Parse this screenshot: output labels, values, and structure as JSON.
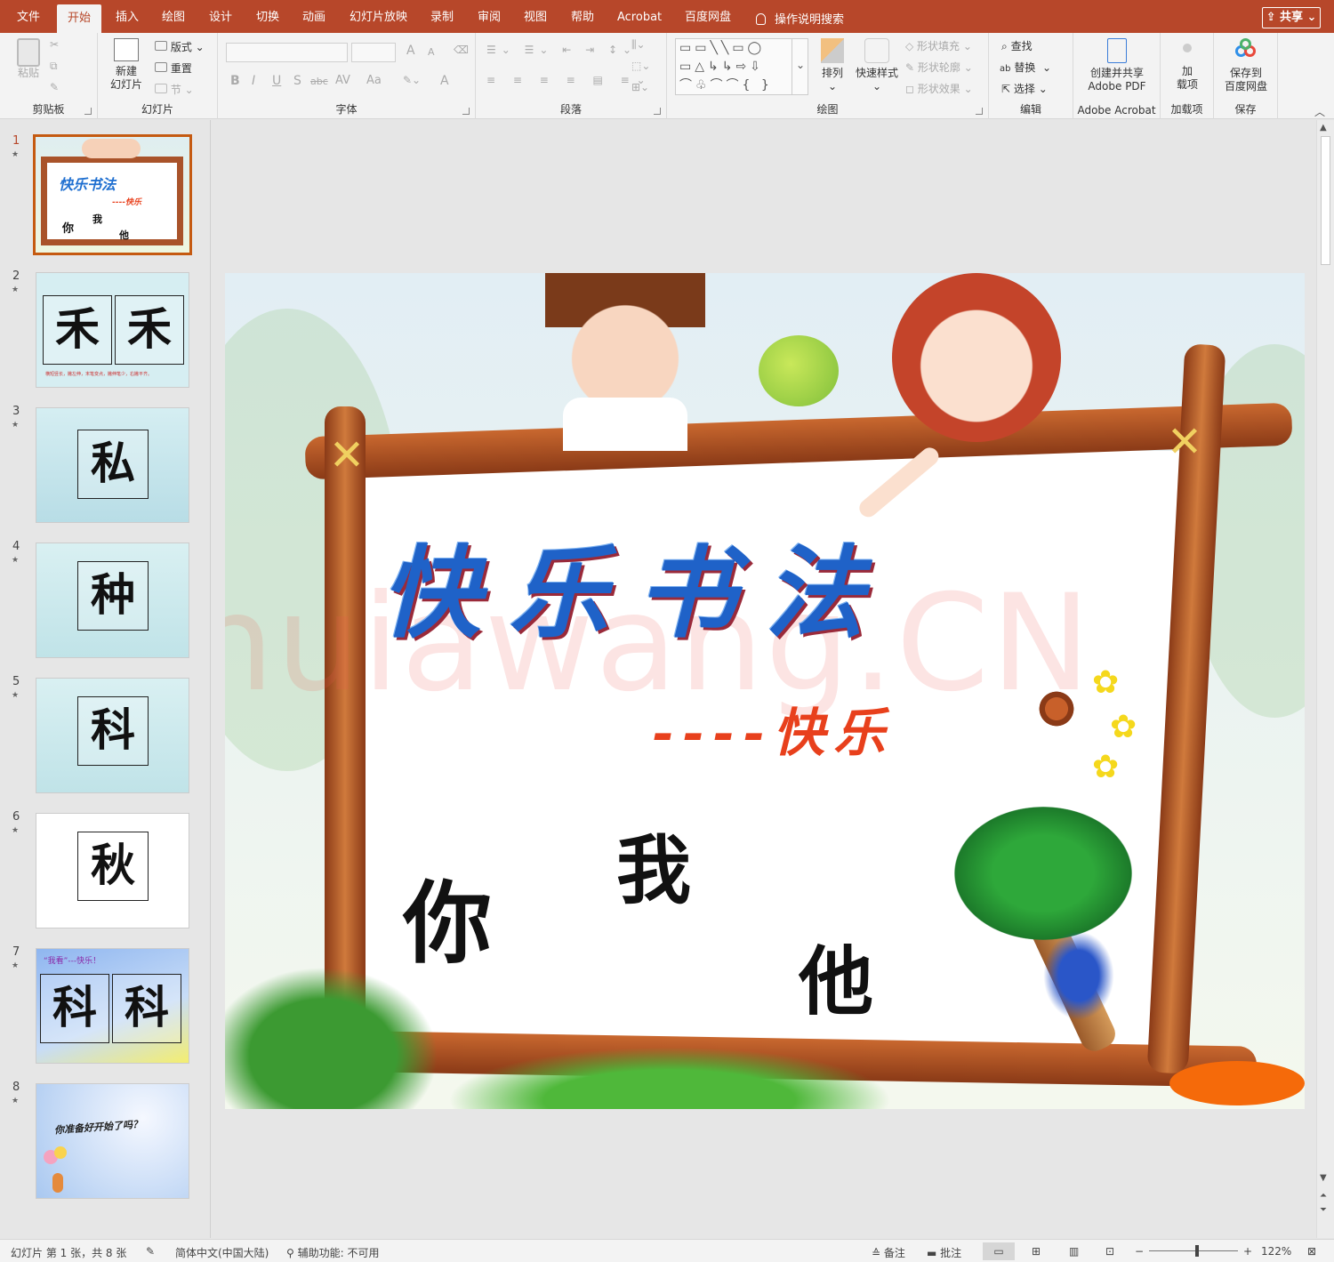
{
  "tabs": [
    "文件",
    "开始",
    "插入",
    "绘图",
    "设计",
    "切换",
    "动画",
    "幻灯片放映",
    "录制",
    "审阅",
    "视图",
    "帮助",
    "Acrobat",
    "百度网盘"
  ],
  "active_tab": "开始",
  "tell_me": "操作说明搜索",
  "share": "共享",
  "ribbon": {
    "clipboard": {
      "label": "剪贴板",
      "paste": "粘贴"
    },
    "slides": {
      "label": "幻灯片",
      "new_slide_1": "新建",
      "new_slide_2": "幻灯片",
      "layout": "版式",
      "reset": "重置",
      "section": "节"
    },
    "font": {
      "label": "字体",
      "increase": "A",
      "decrease": "A",
      "bold": "B",
      "italic": "I",
      "underline": "U",
      "shadow": "S",
      "strike": "abc",
      "spacing": "AV",
      "case": "Aa",
      "color": "A"
    },
    "paragraph": {
      "label": "段落"
    },
    "drawing": {
      "label": "绘图",
      "arrange": "排列",
      "quick_styles": "快速样式",
      "fill": "形状填充",
      "outline": "形状轮廓",
      "effects": "形状效果"
    },
    "editing": {
      "label": "编辑",
      "find": "查找",
      "replace": "替换",
      "select": "选择"
    },
    "acrobat": {
      "label": "Adobe Acrobat",
      "line1": "创建并共享",
      "line2": "Adobe PDF"
    },
    "addins": {
      "label": "加载项",
      "line1": "加",
      "line2": "载项"
    },
    "save": {
      "label": "保存",
      "line1": "保存到",
      "line2": "百度网盘"
    }
  },
  "thumbnails": [
    {
      "num": "1",
      "title": "快乐书法",
      "sub": "----快乐",
      "chars": [
        "你",
        "我",
        "他"
      ]
    },
    {
      "num": "2",
      "chars": [
        "禾",
        "禾"
      ],
      "note": "横短竖长，撇左伸，末笔变点，撇伸笔少，右撇平齐。"
    },
    {
      "num": "3",
      "chars": [
        "私"
      ]
    },
    {
      "num": "4",
      "chars": [
        "种"
      ]
    },
    {
      "num": "5",
      "chars": [
        "科"
      ]
    },
    {
      "num": "6",
      "chars": [
        "秋"
      ]
    },
    {
      "num": "7",
      "caption": "“我看”---快乐！",
      "chars": [
        "科",
        "科"
      ]
    },
    {
      "num": "8",
      "caption": "你准备好开始了吗？"
    }
  ],
  "slide": {
    "title": "快乐书法",
    "subtitle": "----快乐",
    "char1": "你",
    "char2": "我",
    "char3": "他",
    "watermark": "shuiawang.CN"
  },
  "status": {
    "slide_info": "幻灯片 第 1 张，共 8 张",
    "language": "简体中文(中国大陆)",
    "accessibility": "辅助功能: 不可用",
    "notes": "备注",
    "comments": "批注",
    "zoom": "122%"
  }
}
